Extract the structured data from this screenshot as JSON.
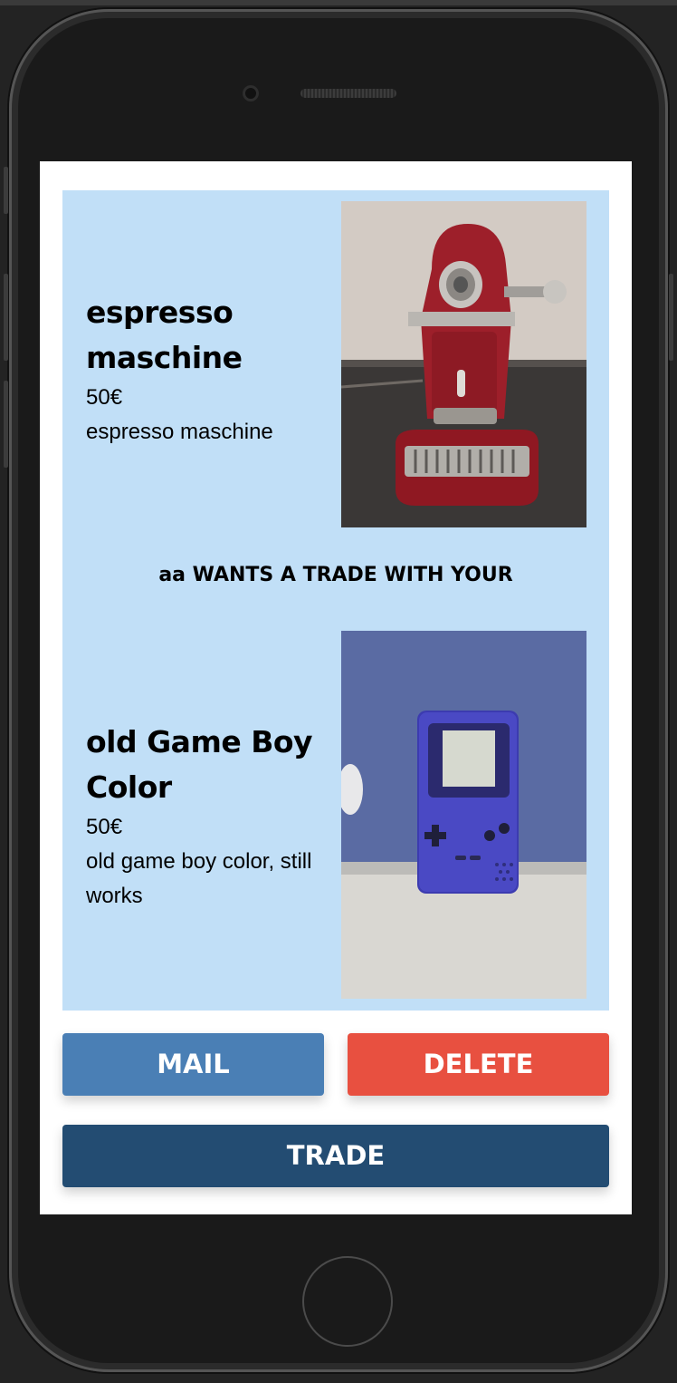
{
  "offer": {
    "requested_item": {
      "title": "espresso maschine",
      "price": "50€",
      "description": "espresso maschine",
      "photo_icon": "espresso-machine-photo"
    },
    "trade_label": "aa WANTS A TRADE WITH YOUR",
    "offered_item": {
      "title": "old Game Boy Color",
      "price": "50€",
      "description": "old game boy color, still works",
      "photo_icon": "game-boy-color-photo"
    }
  },
  "actions": {
    "mail_label": "MAIL",
    "delete_label": "DELETE",
    "trade_label": "TRADE"
  },
  "colors": {
    "card_background": "#c1dff7",
    "mail_button": "#4a7fb5",
    "delete_button": "#e85040",
    "trade_button": "#234c72"
  }
}
